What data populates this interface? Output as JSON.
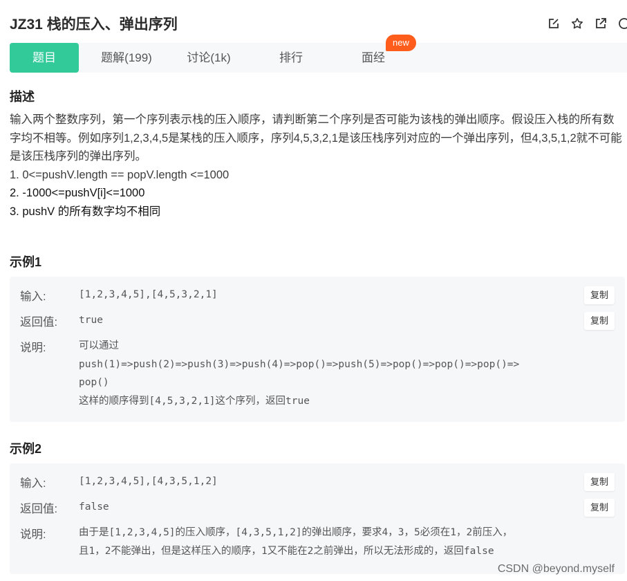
{
  "header": {
    "title": "JZ31  栈的压入、弹出序列",
    "icons": [
      "edit-icon",
      "star-icon",
      "external-link-icon",
      "more-icon"
    ]
  },
  "tabs": [
    {
      "label": "题目",
      "active": true
    },
    {
      "label": "题解(199)"
    },
    {
      "label": "讨论(1k)"
    },
    {
      "label": "排行"
    },
    {
      "label": "面经"
    }
  ],
  "badge": "new",
  "description": {
    "heading": "描述",
    "paragraph": "输入两个整数序列，第一个序列表示栈的压入顺序，请判断第二个序列是否可能为该栈的弹出顺序。假设压入栈的所有数字均不相等。例如序列1,2,3,4,5是某栈的压入顺序，序列4,5,3,2,1是该压栈序列对应的一个弹出序列，但4,3,5,1,2就不可能是该压栈序列的弹出序列。",
    "constraints": [
      "1. 0<=pushV.length == popV.length <=1000",
      "2. -1000<=pushV[i]<=1000",
      "3. pushV 的所有数字均不相同"
    ]
  },
  "example1": {
    "heading": "示例1",
    "input_label": "输入:",
    "input": "[1,2,3,4,5],[4,5,3,2,1]",
    "output_label": "返回值:",
    "output": "true",
    "explain_label": "说明:",
    "explain_line1": "可以通过",
    "explain_line2": "push(1)=>push(2)=>push(3)=>push(4)=>pop()=>push(5)=>pop()=>pop()=>pop()=>",
    "explain_line3": "pop()",
    "explain_line4": "这样的顺序得到[4,5,3,2,1]这个序列，返回true",
    "copy": "复制"
  },
  "example2": {
    "heading": "示例2",
    "input_label": "输入:",
    "input": "[1,2,3,4,5],[4,3,5,1,2]",
    "output_label": "返回值:",
    "output": "false",
    "explain_label": "说明:",
    "explain_line1": "由于是[1,2,3,4,5]的压入顺序，[4,3,5,1,2]的弹出顺序，要求4，3，5必须在1，2前压入，",
    "explain_line2": "且1，2不能弹出，但是这样压入的顺序，1又不能在2之前弹出，所以无法形成的，返回false",
    "copy": "复制"
  },
  "watermark": "CSDN @beyond.myself"
}
